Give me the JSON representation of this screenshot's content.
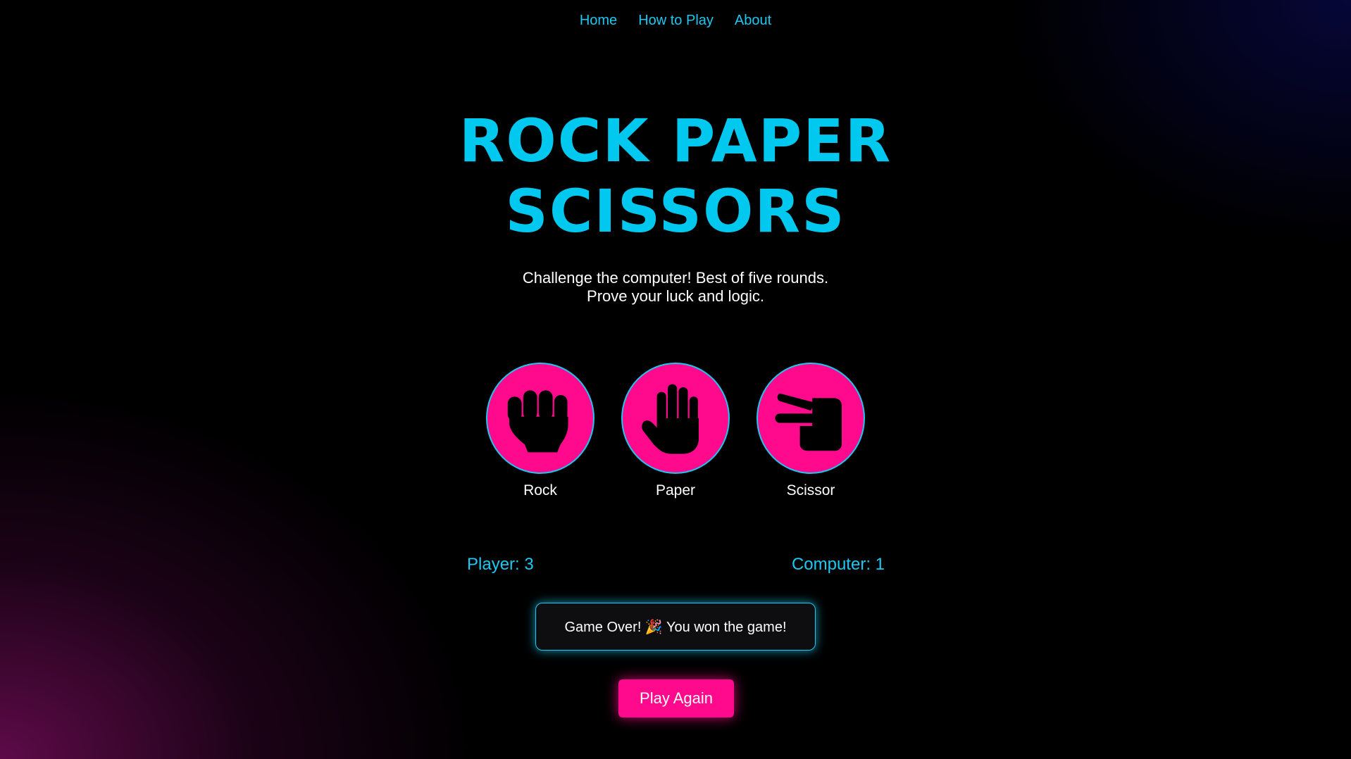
{
  "nav": {
    "items": [
      {
        "label": "Home"
      },
      {
        "label": "How to Play"
      },
      {
        "label": "About"
      }
    ]
  },
  "hero": {
    "title_line1": "ROCK PAPER",
    "title_line2": "SCISSORS",
    "subtitle_line1": "Challenge the computer! Best of five rounds.",
    "subtitle_line2": "Prove your luck and logic."
  },
  "choices": [
    {
      "label": "Rock",
      "icon": "fist-icon"
    },
    {
      "label": "Paper",
      "icon": "open-hand-icon"
    },
    {
      "label": "Scissor",
      "icon": "peace-hand-icon"
    }
  ],
  "score": {
    "player": "Player: 3",
    "computer": "Computer: 1"
  },
  "result": {
    "text": "Game Over! 🎉 You won the game!"
  },
  "actions": {
    "play_again": "Play Again"
  },
  "colors": {
    "accent_cyan": "#1cc8f2",
    "accent_pink": "#ff0a8c",
    "background": "#000000"
  }
}
